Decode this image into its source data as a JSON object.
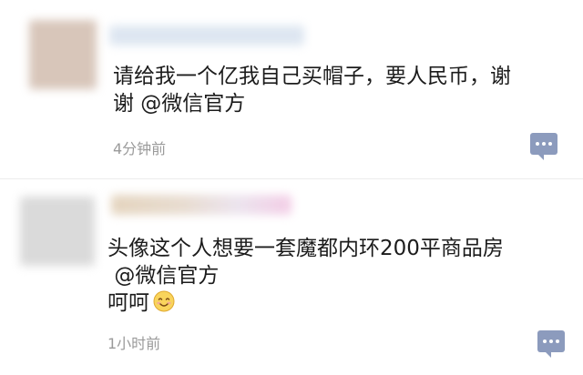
{
  "posts": [
    {
      "text": "请给我一个亿我自己买帽子，要人民币，谢\n谢 @微信官方",
      "time": "4分钟前"
    },
    {
      "text": "头像这个人想要一套魔都内环200平商品房\n @微信官方\n呵呵",
      "time": "1小时前",
      "emoji": "smiling-face-icon"
    }
  ]
}
